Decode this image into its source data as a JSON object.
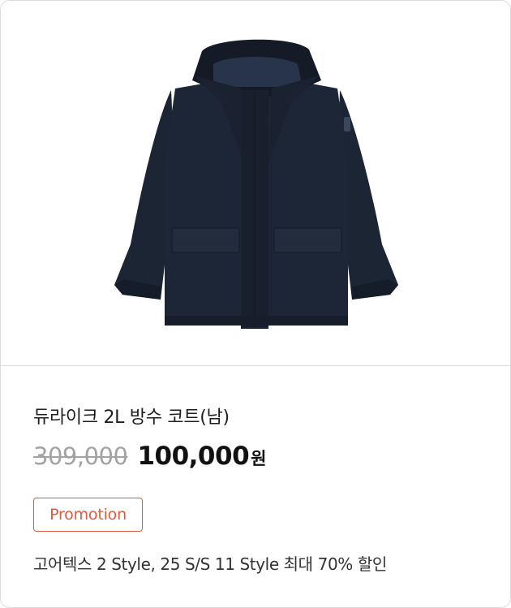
{
  "product": {
    "image_icon": "navy-hooded-coat",
    "name": "듀라이크 2L 방수 코트(남)",
    "original_price": "309,000",
    "sale_price": "100,000",
    "currency": "원",
    "promotion_label": "Promotion",
    "promotion_description": "고어텍스 2 Style, 25 S/S 11 Style 최대 70% 할인"
  },
  "colors": {
    "coat": "#1b2432",
    "promotion_accent": "#e05a3f",
    "strike_price": "#a3a3a3"
  }
}
